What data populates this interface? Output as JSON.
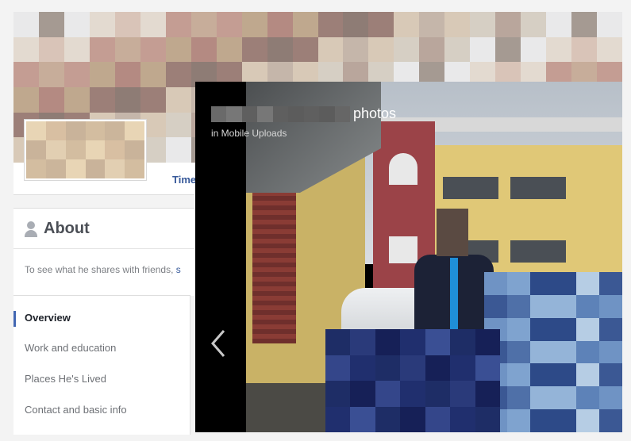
{
  "timeline_tab": "Time",
  "about": {
    "title": "About",
    "text": "To see what he shares with friends,",
    "more": "s"
  },
  "nav": {
    "items": [
      "Overview",
      "Work and education",
      "Places He's Lived",
      "Contact and basic info"
    ]
  },
  "viewer": {
    "title": "photos",
    "subtitle": "in Mobile Uploads"
  },
  "icons": {
    "about": "person-icon",
    "prev": "chevron-left-icon"
  },
  "colors": {
    "link": "#365899",
    "nav_active": "#4267b2",
    "tie": "#1f8fd8"
  }
}
